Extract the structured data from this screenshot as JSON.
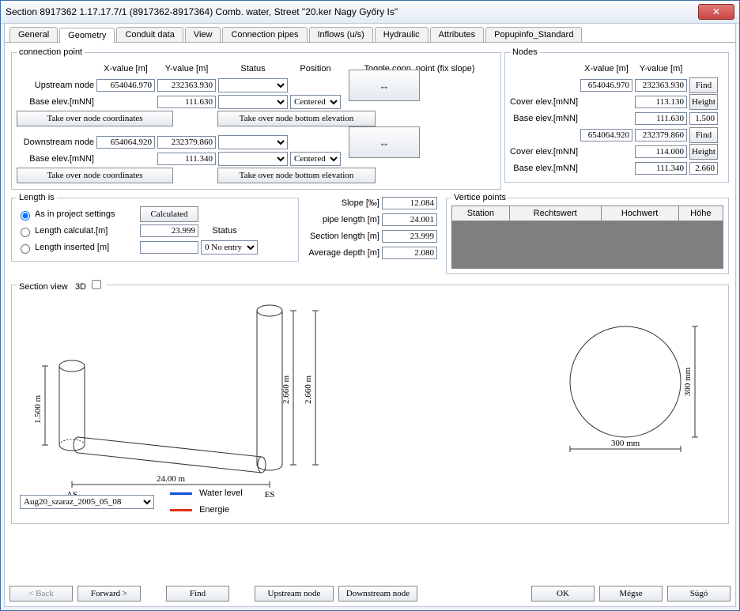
{
  "title": "Section  8917362  1.17.17.7/1  (8917362-8917364)  Comb. water, Street \"20.ker Nagy Győry Is\"",
  "tabs": [
    "General",
    "Geometry",
    "Conduit data",
    "View",
    "Connection pipes",
    "Inflows (u/s)",
    "Hydraulic",
    "Attributes",
    "Popupinfo_Standard"
  ],
  "active_tab": 1,
  "cp": {
    "legend": "connection point",
    "col_x": "X-value [m]",
    "col_y": "Y-value [m]",
    "col_status": "Status",
    "col_pos": "Position",
    "col_toggle": "Toggle conn. point (fix slope)",
    "up_lbl": "Upstream node",
    "dn_lbl": "Downstream node",
    "be_lbl": "Base elev.[mNN]",
    "take_coord": "Take over node coordinates",
    "take_bot": "Take over node bottom elevation",
    "centered": "Centered",
    "up": {
      "x": "654046.970",
      "y": "232363.930",
      "be": "111.630"
    },
    "dn": {
      "x": "654064.920",
      "y": "232379.860",
      "be": "111.340"
    }
  },
  "nodes": {
    "legend": "Nodes",
    "col_x": "X-value [m]",
    "col_y": "Y-value [m]",
    "cover": "Cover elev.[mNN]",
    "base": "Base elev.[mNN]",
    "find": "Find",
    "height": "Height",
    "a": {
      "x": "654046.970",
      "y": "232363.930",
      "cover": "113.130",
      "base": "111.630",
      "height": "1.500"
    },
    "b": {
      "x": "654064.920",
      "y": "232379.860",
      "cover": "114.000",
      "base": "111.340",
      "height": "2.660"
    }
  },
  "length": {
    "legend": "Length is",
    "r1": "As in project settings",
    "r2": "Length calculat.[m]",
    "r3": "Length inserted  [m]",
    "calc": "Calculated",
    "val": "23.999",
    "status_lbl": "Status",
    "status_opt": "0 No entry"
  },
  "slopes": {
    "slope_l": "Slope [‰]",
    "slope_v": "12.084",
    "plen_l": "pipe length [m]",
    "plen_v": "24.001",
    "slen_l": "Section length [m]",
    "slen_v": "23.999",
    "adep_l": "Average depth [m]",
    "adep_v": "2.080"
  },
  "vertice": {
    "legend": "Vertice points",
    "cols": [
      "Station",
      "Rechtswert",
      "Hochwert",
      "Höhe"
    ]
  },
  "section": {
    "legend": "Section view",
    "three_d": "3D",
    "l_as": "AS",
    "l_es": "ES",
    "h_as": "1.500 m",
    "h_es": "2.660 m",
    "h_es2": "2.660 m",
    "len": "24.00 m",
    "diam": "300 mm",
    "diam2": "300 mm",
    "legend_water": "Water level",
    "legend_energy": "Energie",
    "select": "Aug20_szaraz_2005_05_08"
  },
  "footer": {
    "back": "< Back",
    "forward": "Forward >",
    "find": "Find",
    "upn": "Upstream node",
    "dnn": "Downstream node",
    "ok": "OK",
    "cancel": "Mégse",
    "help": "Súgó"
  }
}
